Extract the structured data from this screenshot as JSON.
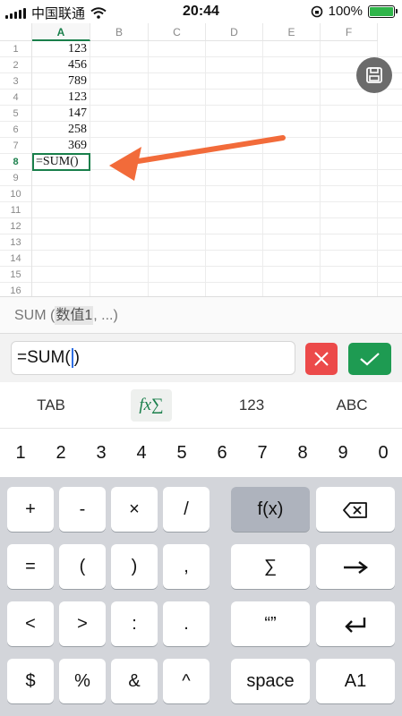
{
  "status_bar": {
    "carrier": "中国联通",
    "time": "20:44",
    "battery_percent": "100%",
    "battery_level": 1.0
  },
  "sheet": {
    "columns": [
      "A",
      "B",
      "C",
      "D",
      "E",
      "F"
    ],
    "active_column": "A",
    "row_numbers": [
      "1",
      "2",
      "3",
      "4",
      "5",
      "6",
      "7",
      "8",
      "9",
      "10",
      "11",
      "12",
      "13",
      "14",
      "15",
      "16"
    ],
    "active_row": "8",
    "column_a_values": [
      "123",
      "456",
      "789",
      "123",
      "147",
      "258",
      "369",
      "=SUM()"
    ],
    "save_icon": "save-icon",
    "annotation_color": "#f26b3a",
    "accent_color": "#1a7f4b"
  },
  "hint": {
    "function": "SUM (",
    "argument": "数值1",
    "rest": ", ...)"
  },
  "formula_bar": {
    "text_before_caret": "=SUM(",
    "text_after_caret": ")",
    "cancel_icon": "close-icon",
    "confirm_icon": "check-icon"
  },
  "modes": {
    "tab": "TAB",
    "functions": "fx∑",
    "numbers": "123",
    "letters": "ABC",
    "active": "functions"
  },
  "digits": [
    "1",
    "2",
    "3",
    "4",
    "5",
    "6",
    "7",
    "8",
    "9",
    "0"
  ],
  "keys": {
    "row1": [
      "+",
      "-",
      "×",
      "/"
    ],
    "fx": "f(x)",
    "backspace_icon": "backspace-icon",
    "row2": [
      "=",
      "(",
      ")",
      ","
    ],
    "sigma": "∑",
    "right_arrow_icon": "right-arrow-icon",
    "row3": [
      "<",
      ">",
      ":",
      "."
    ],
    "quotes": "“”",
    "enter_icon": "enter-icon",
    "row4": [
      "$",
      "%",
      "&",
      "^"
    ],
    "space": "space",
    "cell_ref": "A1"
  }
}
